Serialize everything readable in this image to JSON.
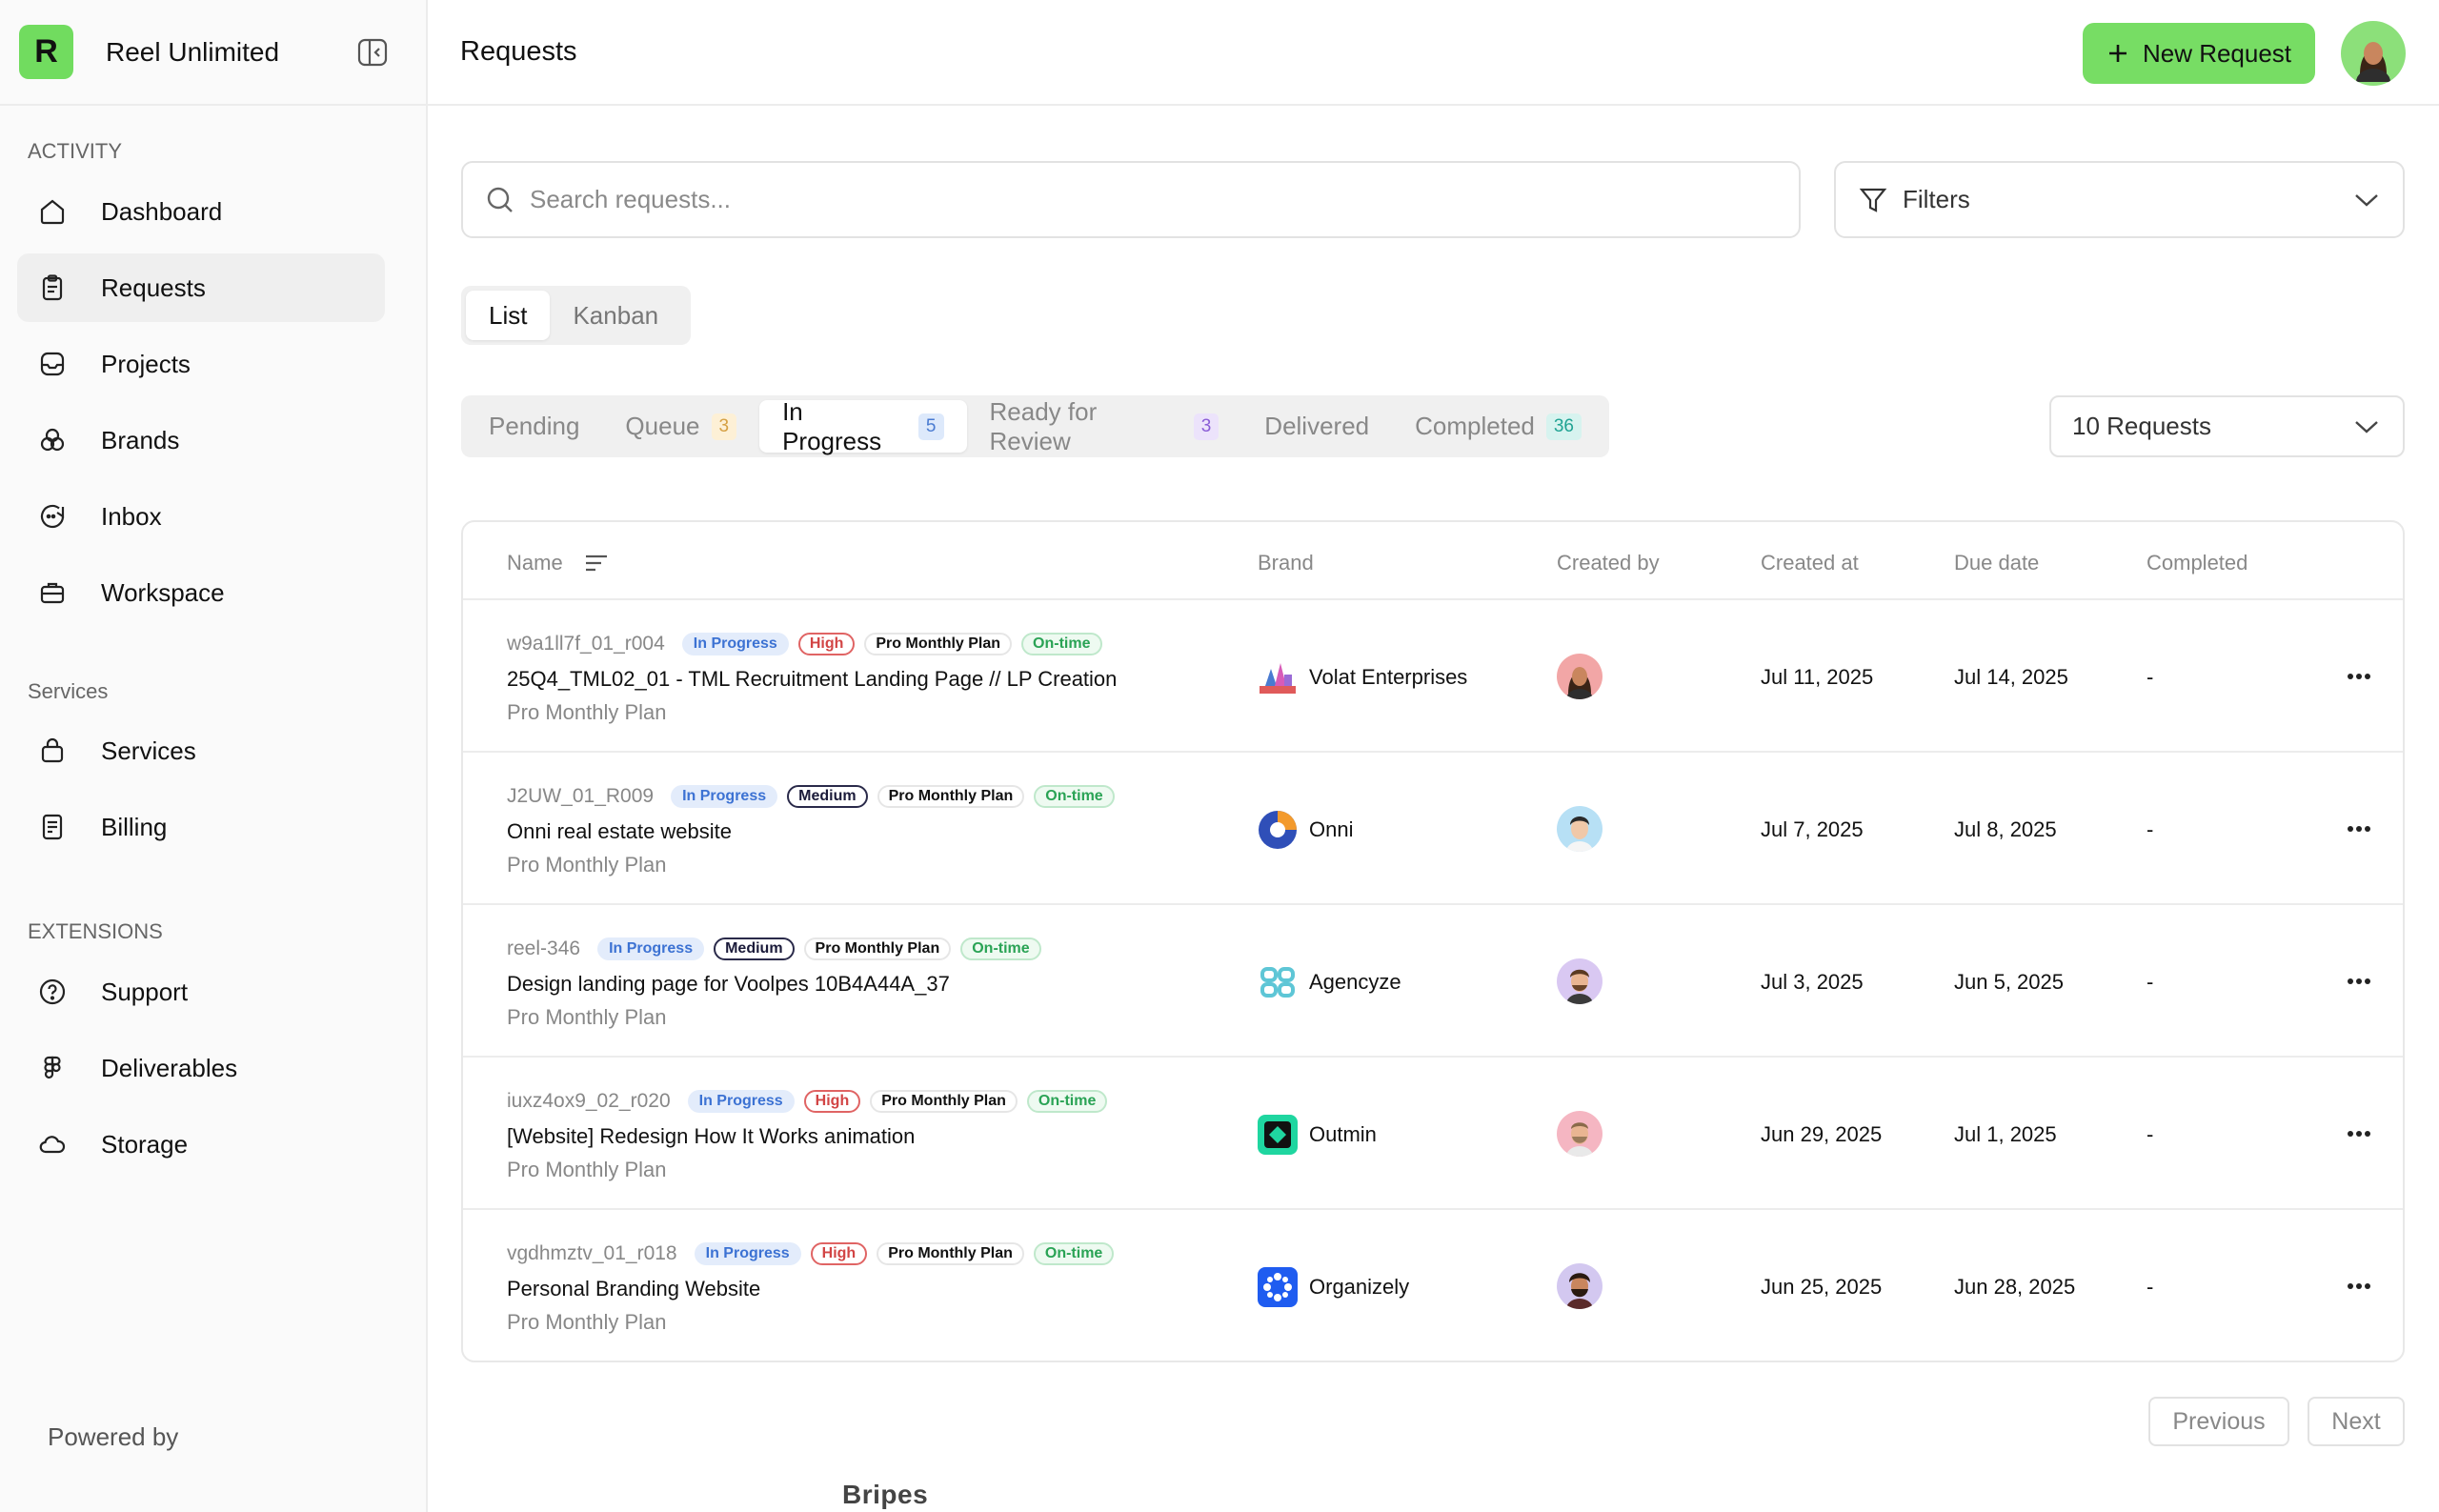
{
  "app": {
    "name": "Reel Unlimited",
    "logo_letter": "R"
  },
  "sidebar": {
    "sections": [
      {
        "label": "ACTIVITY"
      },
      {
        "label": "Services"
      },
      {
        "label": "EXTENSIONS"
      }
    ],
    "items": [
      {
        "label": "Dashboard",
        "icon": "home-icon"
      },
      {
        "label": "Requests",
        "icon": "clipboard-icon",
        "active": true
      },
      {
        "label": "Projects",
        "icon": "inbox-tray-icon"
      },
      {
        "label": "Brands",
        "icon": "brands-icon"
      },
      {
        "label": "Inbox",
        "icon": "chat-icon"
      },
      {
        "label": "Workspace",
        "icon": "briefcase-icon"
      },
      {
        "label": "Services",
        "icon": "bag-icon"
      },
      {
        "label": "Billing",
        "icon": "receipt-icon"
      },
      {
        "label": "Support",
        "icon": "help-circle-icon"
      },
      {
        "label": "Deliverables",
        "icon": "figma-icon"
      },
      {
        "label": "Storage",
        "icon": "cloud-icon"
      }
    ],
    "powered_by": "Powered by",
    "powered_brand": "Bripes"
  },
  "header": {
    "title": "Requests",
    "new_button": "New Request"
  },
  "search": {
    "placeholder": "Search requests...",
    "value": ""
  },
  "filters": {
    "label": "Filters"
  },
  "view_toggle": {
    "list": "List",
    "kanban": "Kanban",
    "active": "List"
  },
  "status_tabs": [
    {
      "label": "Pending",
      "count": ""
    },
    {
      "label": "Queue",
      "count": "3"
    },
    {
      "label": "In Progress",
      "count": "5",
      "active": true
    },
    {
      "label": "Ready for Review",
      "count": "3"
    },
    {
      "label": "Delivered",
      "count": ""
    },
    {
      "label": "Completed",
      "count": "36"
    }
  ],
  "per_page": {
    "label": "10 Requests"
  },
  "table": {
    "columns": {
      "name": "Name",
      "brand": "Brand",
      "created_by": "Created by",
      "created_at": "Created at",
      "due_date": "Due date",
      "completed": "Completed"
    },
    "rows": [
      {
        "id": "w9a1ll7f_01_r004",
        "status": "In Progress",
        "priority": "High",
        "plan_tag": "Pro Monthly Plan",
        "timing": "On-time",
        "title": "25Q4_TML02_01 - TML Recruitment Landing Page // LP Creation",
        "plan": "Pro Monthly Plan",
        "brand": "Volat Enterprises",
        "created_at": "Jul 11, 2025",
        "due_date": "Jul 14, 2025",
        "completed": "-"
      },
      {
        "id": "J2UW_01_R009",
        "status": "In Progress",
        "priority": "Medium",
        "plan_tag": "Pro Monthly Plan",
        "timing": "On-time",
        "title": "Onni real estate website",
        "plan": "Pro Monthly Plan",
        "brand": "Onni",
        "created_at": "Jul 7, 2025",
        "due_date": "Jul 8, 2025",
        "completed": "-"
      },
      {
        "id": "reel-346",
        "status": "In Progress",
        "priority": "Medium",
        "plan_tag": "Pro Monthly Plan",
        "timing": "On-time",
        "title": "Design landing page for Voolpes 10B4A44A_37",
        "plan": "Pro Monthly Plan",
        "brand": "Agencyze",
        "created_at": "Jul 3, 2025",
        "due_date": "Jun 5, 2025",
        "completed": "-"
      },
      {
        "id": "iuxz4ox9_02_r020",
        "status": "In Progress",
        "priority": "High",
        "plan_tag": "Pro Monthly Plan",
        "timing": "On-time",
        "title": "[Website] Redesign How It Works animation",
        "plan": "Pro Monthly Plan",
        "brand": "Outmin",
        "created_at": "Jun 29, 2025",
        "due_date": "Jul 1, 2025",
        "completed": "-"
      },
      {
        "id": "vgdhmztv_01_r018",
        "status": "In Progress",
        "priority": "High",
        "plan_tag": "Pro Monthly Plan",
        "timing": "On-time",
        "title": "Personal Branding Website",
        "plan": "Pro Monthly Plan",
        "brand": "Organizely",
        "created_at": "Jun 25, 2025",
        "due_date": "Jun 28, 2025",
        "completed": "-"
      }
    ]
  },
  "pagination": {
    "previous": "Previous",
    "next": "Next"
  },
  "colors": {
    "accent": "#77dd64",
    "logo": "#71dc5f"
  }
}
